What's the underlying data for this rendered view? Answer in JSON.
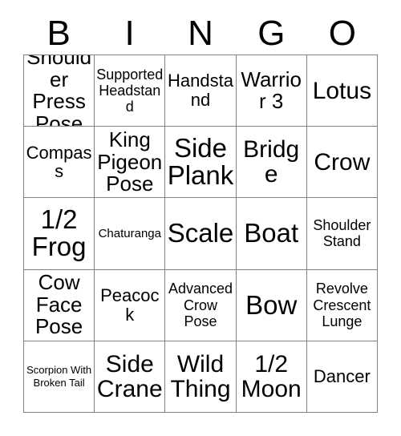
{
  "card": {
    "title": "BINGO",
    "header_letters": [
      "B",
      "I",
      "N",
      "G",
      "O"
    ],
    "rows": 5,
    "columns": 5,
    "border_color": "#808080",
    "text_color": "#000000",
    "background_color": "#ffffff"
  },
  "cells": [
    {
      "text": "Shoulder Press Pose",
      "size": "lg"
    },
    {
      "text": "Supported Headstand",
      "size": "sm"
    },
    {
      "text": "Handstand",
      "size": "md"
    },
    {
      "text": "Warrior 3",
      "size": "lg"
    },
    {
      "text": "Lotus",
      "size": "xl"
    },
    {
      "text": "Compass",
      "size": "md"
    },
    {
      "text": "King Pigeon Pose",
      "size": "lg"
    },
    {
      "text": "Side Plank",
      "size": "xxl"
    },
    {
      "text": "Bridge",
      "size": "xl"
    },
    {
      "text": "Crow",
      "size": "xl"
    },
    {
      "text": "1/2 Frog",
      "size": "xxl"
    },
    {
      "text": "Chaturanga",
      "size": "xs"
    },
    {
      "text": "Scale",
      "size": "xxl"
    },
    {
      "text": "Boat",
      "size": "xxl"
    },
    {
      "text": "Shoulder Stand",
      "size": "sm"
    },
    {
      "text": "Cow Face Pose",
      "size": "lg"
    },
    {
      "text": "Peacock",
      "size": "md"
    },
    {
      "text": "Advanced Crow Pose",
      "size": "sm"
    },
    {
      "text": "Bow",
      "size": "xxl"
    },
    {
      "text": "Revolve Crescent Lunge",
      "size": "sm"
    },
    {
      "text": "Scorpion With Broken Tail",
      "size": "xxs"
    },
    {
      "text": "Side Crane",
      "size": "xl"
    },
    {
      "text": "Wild Thing",
      "size": "xl"
    },
    {
      "text": "1/2 Moon",
      "size": "xl"
    },
    {
      "text": "Dancer",
      "size": "md"
    }
  ]
}
